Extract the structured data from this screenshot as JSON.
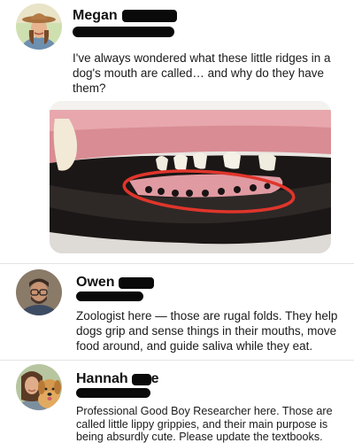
{
  "posts": [
    {
      "author": "Megan",
      "text": "I've always wondered what these little ridges in a dog's mouth are called… and why do they have them?"
    },
    {
      "author": "Owen",
      "text": "Zoologist here — those are rugal folds. They help dogs grip and sense things in their mouths, move food around, and guide saliva while they eat."
    },
    {
      "author": "Hannah",
      "name_suffix_visible": "e",
      "text": "Professional Good Boy Researcher here. Those are called little lippy grippies, and their main purpose is being absurdly cute. Please update the textbooks."
    }
  ],
  "colors": {
    "redaction": "#0a0a0a",
    "annotation_circle": "#e0352b",
    "divider": "#e4e4e4"
  },
  "icons": {
    "post1_avatar": "woman-in-hat-avatar",
    "post2_avatar": "man-with-glasses-avatar",
    "post3_avatar": "woman-with-dog-avatar",
    "photo": "dog-mouth-closeup-photo"
  }
}
